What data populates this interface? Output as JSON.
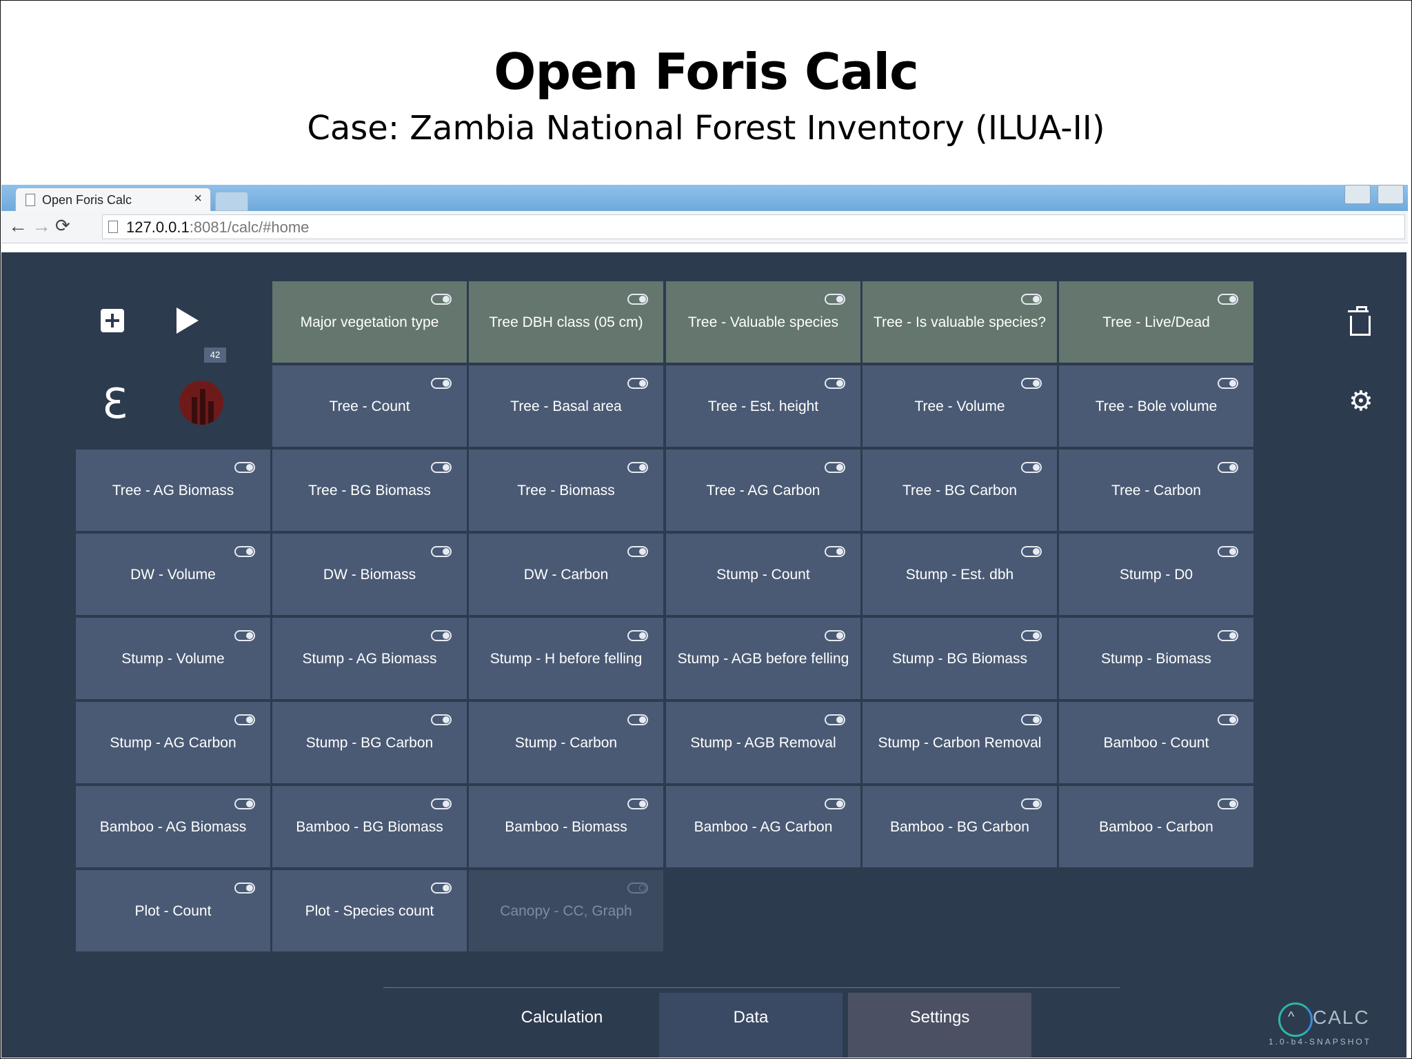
{
  "slide": {
    "title": "Open Foris Calc",
    "subtitle": "Case: Zambia National Forest Inventory (ILUA-II)"
  },
  "browser": {
    "tab_title": "Open Foris Calc",
    "tab_close": "×",
    "url_host": "127.0.0.1",
    "url_rest": ":8081/calc/#home",
    "icons": [
      "back-icon",
      "forward-icon",
      "reload-icon",
      "page-icon"
    ]
  },
  "toolbar": {
    "run_count": "42",
    "epsilon": "ℇ",
    "icons": [
      "plus-icon",
      "play-icon",
      "epsilon-icon",
      "logo-icon",
      "trash-icon",
      "gear-icon"
    ]
  },
  "tiles": {
    "row1": [
      "Major vegetation type",
      "Tree DBH class (05 cm)",
      "Tree - Valuable species",
      "Tree - Is valuable species?",
      "Tree - Live/Dead"
    ],
    "row2": [
      "Tree - Count",
      "Tree - Basal area",
      "Tree - Est. height",
      "Tree - Volume",
      "Tree - Bole volume"
    ],
    "row3": [
      "Tree - AG Biomass",
      "Tree - BG Biomass",
      "Tree - Biomass",
      "Tree - AG Carbon",
      "Tree - BG Carbon",
      "Tree - Carbon"
    ],
    "row4": [
      "DW - Volume",
      "DW - Biomass",
      "DW - Carbon",
      "Stump - Count",
      "Stump - Est. dbh",
      "Stump - D0"
    ],
    "row5": [
      "Stump - Volume",
      "Stump - AG Biomass",
      "Stump - H before felling",
      "Stump - AGB before felling",
      "Stump - BG Biomass",
      "Stump - Biomass"
    ],
    "row6": [
      "Stump - AG Carbon",
      "Stump - BG Carbon",
      "Stump - Carbon",
      "Stump - AGB Removal",
      "Stump - Carbon Removal",
      "Bamboo - Count"
    ],
    "row7": [
      "Bamboo - AG Biomass",
      "Bamboo - BG Biomass",
      "Bamboo - Biomass",
      "Bamboo - AG Carbon",
      "Bamboo - BG Carbon",
      "Bamboo - Carbon"
    ],
    "row8": [
      "Plot - Count",
      "Plot - Species count",
      "Canopy - CC, Graph"
    ],
    "disabled": [
      "Canopy - CC, Graph"
    ]
  },
  "nav": {
    "calculation": "Calculation",
    "data": "Data",
    "settings": "Settings"
  },
  "brand": {
    "name": "CALC",
    "version": "1.0-b4-SNAPSHOT"
  },
  "colors": {
    "app_bg": "#2d3b4f",
    "tile": "#4a5a74",
    "tile_top": "#64766e",
    "brand_teal": "#2fb6a8"
  }
}
